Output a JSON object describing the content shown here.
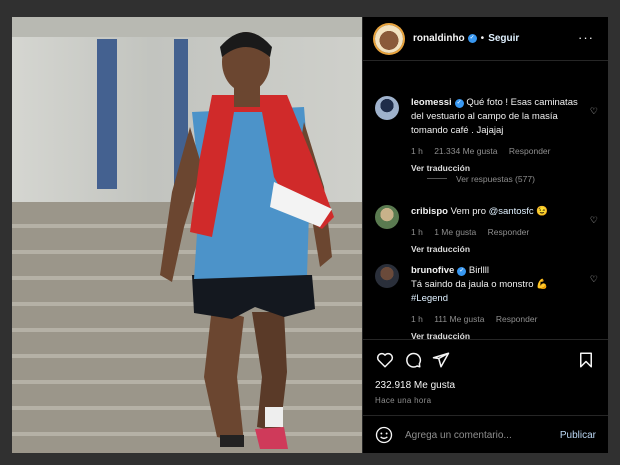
{
  "post": {
    "username": "ronaldinho",
    "follow_label": "Seguir",
    "more_label": "···"
  },
  "comments": [
    {
      "username": "leomessi",
      "text": "Qué foto ! Esas caminatas del vestuario al campo de la masía tomando café . Jajajaj",
      "time": "1 h",
      "likes": "21.334 Me gusta",
      "reply_label": "Responder",
      "translate_label": "Ver traducción"
    },
    {
      "username": "cribispo",
      "text_prefix": "Vem pro ",
      "mention": "@santosfc",
      "text_suffix": " 😉",
      "time": "1 h",
      "likes": "1 Me gusta",
      "reply_label": "Responder",
      "translate_label": "Ver traducción"
    },
    {
      "username": "brunofive",
      "text_line1": "Birllll",
      "text_line2": "Tá saindo da jaula o monstro 💪",
      "hashtag": "#Legend",
      "time": "1 h",
      "likes": "111 Me gusta",
      "reply_label": "Responder",
      "translate_label": "Ver traducción"
    }
  ],
  "view_replies": "Ver respuestas (577)",
  "actions": {
    "likes_count": "232.918 Me gusta",
    "posted_time": "Hace una hora"
  },
  "add_comment": {
    "placeholder": "Agrega un comentario...",
    "publish_label": "Publicar"
  },
  "icons": [
    "heart-icon",
    "comment-icon",
    "share-icon",
    "bookmark-icon",
    "emoji-icon",
    "verified-icon",
    "more-icon"
  ],
  "colors": {
    "accent": "#3897f0",
    "background": "#000000",
    "muted": "#8e8e8e"
  }
}
